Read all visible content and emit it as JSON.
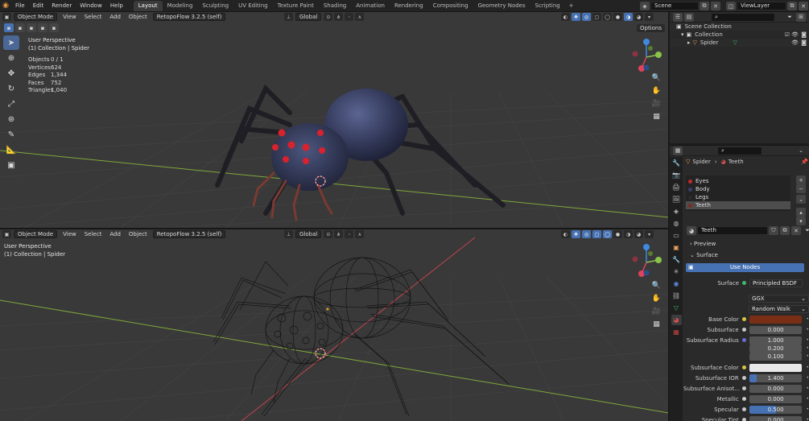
{
  "topbar": {
    "menu": [
      "File",
      "Edit",
      "Render",
      "Window",
      "Help"
    ],
    "workspaces": [
      "Layout",
      "Modeling",
      "Sculpting",
      "UV Editing",
      "Texture Paint",
      "Shading",
      "Animation",
      "Rendering",
      "Compositing",
      "Geometry Nodes",
      "Scripting"
    ],
    "active_workspace": "Layout",
    "scene": "Scene",
    "view_layer": "ViewLayer"
  },
  "viewport_top": {
    "mode": "Object Mode",
    "menus": [
      "View",
      "Select",
      "Add",
      "Object"
    ],
    "addon": "RetopoFlow 3.2.5 (self)",
    "orientation": "Global",
    "options_label": "Options",
    "perspective": "User Perspective",
    "collection_info": "(1) Collection | Spider",
    "stats": [
      {
        "label": "Objects",
        "value": "0 / 1"
      },
      {
        "label": "Vertices",
        "value": "624"
      },
      {
        "label": "Edges",
        "value": "1,344"
      },
      {
        "label": "Faces",
        "value": "752"
      },
      {
        "label": "Triangles",
        "value": "1,040"
      }
    ]
  },
  "viewport_bottom": {
    "mode": "Object Mode",
    "menus": [
      "View",
      "Select",
      "Add",
      "Object"
    ],
    "addon": "RetopoFlow 3.2.5 (self)",
    "orientation": "Global",
    "perspective": "User Perspective",
    "collection_info": "(1) Collection | Spider"
  },
  "outliner": {
    "scene_collection": "Scene Collection",
    "collection": "Collection",
    "object": "Spider"
  },
  "properties": {
    "breadcrumb_object": "Spider",
    "breadcrumb_material": "Teeth",
    "slots": [
      {
        "name": "Eyes",
        "color": "#c02a2a"
      },
      {
        "name": "Body",
        "color": "#3a3f6a"
      },
      {
        "name": "Legs",
        "color": "#2a2a2a"
      },
      {
        "name": "Teeth",
        "color": "#7a2e22"
      }
    ],
    "selected_slot": "Teeth",
    "material_name": "Teeth",
    "preview_label": "Preview",
    "surface_panel": "Surface",
    "use_nodes_label": "Use Nodes",
    "surface_label": "Surface",
    "surface_shader": "Principled BSDF",
    "distribution": "GGX",
    "subsurface_method": "Random Walk",
    "rows": [
      {
        "label": "Base Color",
        "value": "",
        "color": "#7b2e16",
        "dot": "yellow"
      },
      {
        "label": "Subsurface",
        "value": "0.000",
        "dot": "grey"
      },
      {
        "label": "Subsurface Radius",
        "value": "1.000",
        "dot": "purple"
      },
      {
        "label": "",
        "value": "0.200",
        "dot": "none"
      },
      {
        "label": "",
        "value": "0.100",
        "dot": "none"
      },
      {
        "label": "Subsurface Color",
        "value": "",
        "color": "#e8e8e8",
        "dot": "yellow"
      },
      {
        "label": "Subsurface IOR",
        "value": "1.400",
        "dot": "grey",
        "fill": 0.14
      },
      {
        "label": "Subsurface Anisot...",
        "value": "0.000",
        "dot": "grey"
      },
      {
        "label": "Metallic",
        "value": "0.000",
        "dot": "grey"
      },
      {
        "label": "Specular",
        "value": "0.500",
        "dot": "grey",
        "fill": 0.5
      },
      {
        "label": "Specular Tint",
        "value": "0.000",
        "dot": "grey"
      }
    ]
  },
  "colors": {
    "accent": "#4672b4",
    "viewport_bg": "#393939",
    "x_axis": "#e0435b",
    "y_axis": "#8bc34a",
    "z_axis": "#3f8ae0"
  }
}
